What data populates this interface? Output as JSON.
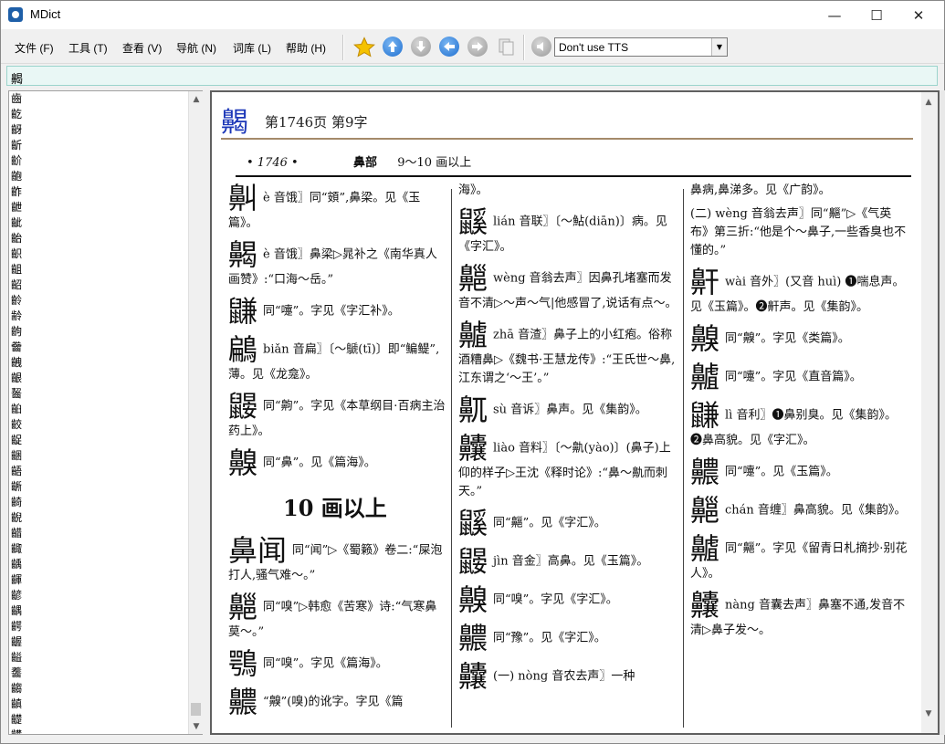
{
  "window": {
    "title": "MDict",
    "minimize": "—",
    "maximize": "☐",
    "close": "✕"
  },
  "menu": [
    {
      "label": "文件 (F)"
    },
    {
      "label": "工具 (T)"
    },
    {
      "label": "查看 (V)"
    },
    {
      "label": "导航 (N)"
    },
    {
      "label": "词库 (L)"
    },
    {
      "label": "帮助 (H)"
    }
  ],
  "toolbar": {
    "icons": [
      "favorite-star-icon",
      "up-arrow-icon",
      "down-arrow-icon",
      "back-arrow-icon",
      "forward-arrow-icon",
      "copy-icon",
      "speaker-icon"
    ],
    "tts_value": "Don't use TTS"
  },
  "search": {
    "value": "齃"
  },
  "word_list": {
    "items": [
      "齒",
      "齕",
      "齖",
      "齗",
      "齘",
      "齙",
      "齚",
      "齛",
      "齜",
      "齝",
      "齞",
      "齟",
      "齠",
      "齡",
      "齢",
      "齣",
      "齤",
      "齥",
      "齦",
      "齧",
      "齨",
      "齩",
      "齪",
      "齫",
      "齬",
      "齭",
      "齮",
      "齯",
      "齰",
      "齱",
      "齲",
      "齳",
      "齴",
      "齵",
      "齶",
      "齷",
      "齸",
      "齹",
      "齺",
      "齻",
      "齼",
      "齽",
      "齾",
      "齃"
    ],
    "selected": "齃"
  },
  "entry": {
    "headword": "齃",
    "page_info": "第1746页 第9字"
  },
  "scan": {
    "page_num": "• 1746 •",
    "radical": "鼻部",
    "stroke_range": "9～10 画以上",
    "section_title": "10 画以上",
    "col1": [
      {
        "big": "鼼",
        "text": "è 音饿〗同“頞”,鼻梁。见《玉篇》。"
      },
      {
        "big": "齃",
        "text": "è 音饿〗鼻梁▷晁补之《南华真人画赞》:“口海～岳。”"
      },
      {
        "big": "鼸",
        "text": "同“嚏”。字见《字汇补》。"
      },
      {
        "big": "鶣",
        "text": "biǎn 音扁〗〔～鷈(tī)〕即“鳊鳀”,薄。见《龙龛》。"
      },
      {
        "big": "鼹",
        "text": "同“齁”。字见《本草纲目·百病主治药上》。"
      },
      {
        "big": "齅",
        "text": "同“鼻”。见《篇海》。"
      },
      {
        "big": "鼻闻",
        "text": "同“闻”▷《蜀籁》卷二:“屎泡打人,骚气难～。”"
      },
      {
        "big": "齆",
        "text": "同“嗅”▷韩愈《苦寒》诗:“气寒鼻莫～。”"
      },
      {
        "big": "鶚",
        "text": "同“嗅”。字见《篇海》。"
      },
      {
        "big": "齈",
        "text": "“齅”(嗅)的讹字。字见《篇"
      }
    ],
    "col2": [
      {
        "big": "",
        "text": "海》。"
      },
      {
        "big": "鼷",
        "text": "lián 音联〗〔～鮎(diān)〕病。见《字汇》。"
      },
      {
        "big": "齆",
        "text": "wèng 音翁去声〗因鼻孔堵塞而发音不清▷～声～气|他感冒了,说话有点～。"
      },
      {
        "big": "齇",
        "text": "zhā 音渣〗鼻子上的小红疱。俗称酒糟鼻▷《魏书·王慧龙传》:“王氏世～鼻,江东谓之‘～王’。”"
      },
      {
        "big": "鼿",
        "text": "sù 音诉〗鼻声。见《集韵》。"
      },
      {
        "big": "齉",
        "text": "liào 音料〗〔～鼽(yào)〕(鼻子)上仰的样子▷王沈《释时论》:“鼻～鼽而刺天。”"
      },
      {
        "big": "鼷",
        "text": "同“齆”。见《字汇》。"
      },
      {
        "big": "鼹",
        "text": "jìn 音金〗高鼻。见《玉篇》。"
      },
      {
        "big": "齅",
        "text": "同“嗅”。字见《字汇》。"
      },
      {
        "big": "齈",
        "text": "同“豫”。见《字汇》。"
      },
      {
        "big": "齉",
        "text": "(一) nòng 音农去声〗一种"
      }
    ],
    "col3": [
      {
        "big": "",
        "text": "鼻病,鼻涕多。见《广韵》。"
      },
      {
        "big": "",
        "text": "(二) wèng 音翁去声〗同“齆”▷《气英布》第三折:“他是个～鼻子,一些香臭也不懂的。”"
      },
      {
        "big": "鼾",
        "text": "wài 音外〗(又音 huì) ❶喘息声。见《玉篇》。❷鼾声。见《集韵》。"
      },
      {
        "big": "齅",
        "text": "同“齅”。字见《类篇》。"
      },
      {
        "big": "齇",
        "text": "同“嚏”。字见《直音篇》。"
      },
      {
        "big": "鼸",
        "text": "lì 音利〗❶鼻别臭。见《集韵》。❷鼻高貌。见《字汇》。"
      },
      {
        "big": "齈",
        "text": "同“嚏”。见《玉篇》。"
      },
      {
        "big": "齆",
        "text": "chán 音缠〗鼻高貌。见《集韵》。"
      },
      {
        "big": "齇",
        "text": "同“齆”。字见《留青日札摘抄·别花人》。"
      },
      {
        "big": "齉",
        "text": "nàng 音囊去声〗鼻塞不通,发音不清▷鼻子发～。"
      }
    ]
  }
}
